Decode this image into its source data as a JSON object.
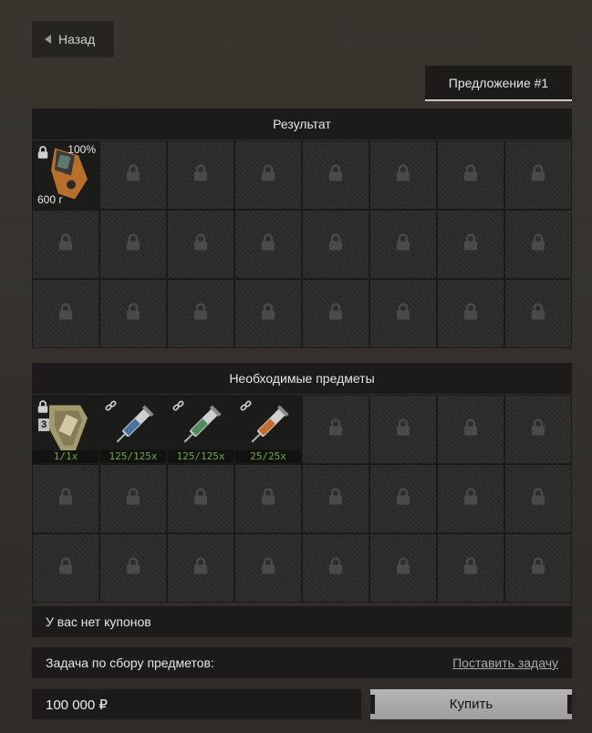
{
  "nav": {
    "back_label": "Назад"
  },
  "tabs": [
    {
      "label": "Предложение #1"
    }
  ],
  "result": {
    "header": "Результат",
    "item": {
      "icon": "handheld-device-icon",
      "durability": "100%",
      "weight": "600 г"
    }
  },
  "required": {
    "header": "Необходимые предметы",
    "items": [
      {
        "icon": "case-icon",
        "level": "3",
        "count": "1/1x"
      },
      {
        "icon": "syringe-blue-icon",
        "count": "125/125x"
      },
      {
        "icon": "syringe-green-icon",
        "count": "125/125x"
      },
      {
        "icon": "syringe-orange-icon",
        "count": "25/25x"
      }
    ]
  },
  "coupons": {
    "text": "У вас нет купонов"
  },
  "task": {
    "label": "Задача по сбору предметов:",
    "link": "Поставить задачу"
  },
  "purchase": {
    "price": "100 000 ₽",
    "buy_label": "Купить"
  },
  "colors": {
    "accent_green": "#6ea748",
    "panel": "#1c1b19",
    "background": "#35322d"
  }
}
